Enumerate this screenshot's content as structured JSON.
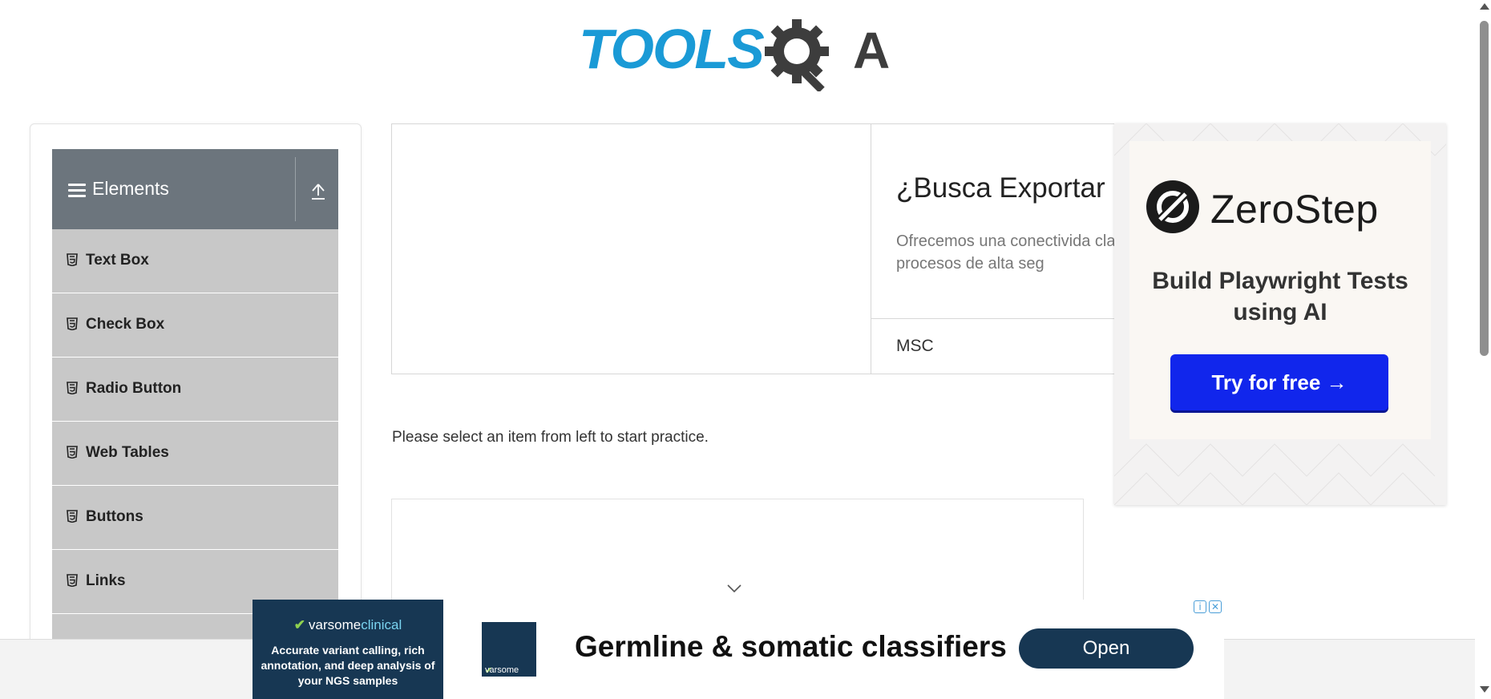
{
  "header": {
    "logo_text": "TOOLSQA"
  },
  "sidebar": {
    "group_title": "Elements",
    "items": [
      {
        "label": "Text Box"
      },
      {
        "label": "Check Box"
      },
      {
        "label": "Radio Button"
      },
      {
        "label": "Web Tables"
      },
      {
        "label": "Buttons"
      },
      {
        "label": "Links"
      },
      {
        "label": ""
      }
    ]
  },
  "top_ad": {
    "headline": "¿Busca Exportar",
    "description": "Ofrecemos una conectivida clase y procesos de alta seg",
    "brand": "MSC"
  },
  "main": {
    "prompt": "Please select an item from left to start practice."
  },
  "right_ad": {
    "brand": "ZeroStep",
    "tagline": "Build Playwright Tests using AI",
    "cta": "Try for free →"
  },
  "bottom_ad": {
    "brand_main": "varsome",
    "brand_sub": "clinical",
    "description": "Accurate variant calling, rich annotation, and deep analysis of your NGS samples",
    "thumb_text": "varsome",
    "headline": "Germline & somatic classifiers",
    "cta": "Open"
  },
  "colors": {
    "sidebar_header": "#6c757d",
    "sidebar_item": "#c8c8c8",
    "cta_blue": "#1126ec",
    "varsome_navy": "#173753",
    "logo_blue": "#1a9ad6"
  }
}
